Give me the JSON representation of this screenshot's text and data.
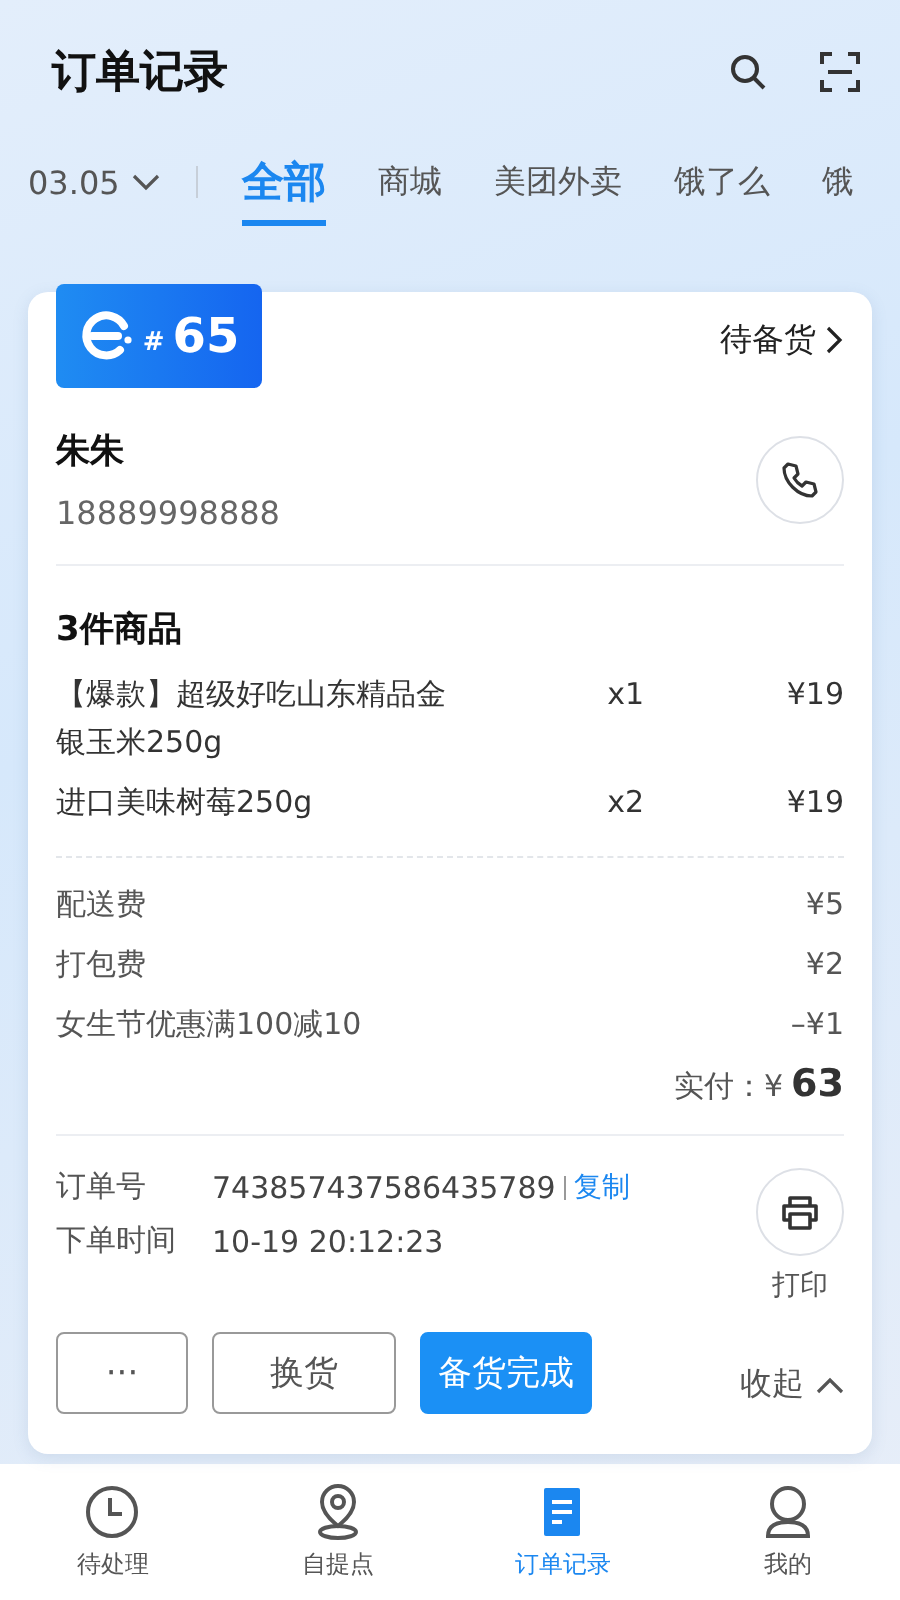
{
  "header": {
    "title": "订单记录"
  },
  "date_filter": "03.05",
  "tabs": [
    {
      "label": "全部",
      "selected": true
    },
    {
      "label": "商城",
      "selected": false
    },
    {
      "label": "美团外卖",
      "selected": false
    },
    {
      "label": "饿了么",
      "selected": false
    },
    {
      "label": "饿",
      "selected": false
    }
  ],
  "order": {
    "badge": {
      "prefix": "#",
      "number": "65"
    },
    "status": "待备货",
    "customer": {
      "name": "朱朱",
      "phone": "18889998888"
    },
    "items_title": "3件商品",
    "items": [
      {
        "name": "【爆款】超级好吃山东精品金银玉米250g",
        "qty": "x1",
        "price": "¥19"
      },
      {
        "name": "进口美味树莓250g",
        "qty": "x2",
        "price": "¥19"
      }
    ],
    "fees": [
      {
        "label": "配送费",
        "amount": "¥5"
      },
      {
        "label": "打包费",
        "amount": "¥2"
      },
      {
        "label": "女生节优惠满100减10",
        "amount": "–¥1"
      }
    ],
    "total": {
      "label": "实付：¥",
      "value": "63"
    },
    "info": [
      {
        "label": "订单号",
        "value": "743857437586435789",
        "link": "复制"
      },
      {
        "label": "下单时间",
        "value": "10-19 20:12:23"
      }
    ],
    "print_label": "打印",
    "buttons": [
      {
        "label": "···",
        "kind": "outline"
      },
      {
        "label": "换货",
        "kind": "outline"
      },
      {
        "label": "备货完成",
        "kind": "primary"
      }
    ],
    "collapse": "收起"
  },
  "bottom_nav": [
    {
      "label": "待处理",
      "selected": false
    },
    {
      "label": "自提点",
      "selected": false
    },
    {
      "label": "订单记录",
      "selected": true
    },
    {
      "label": "我的",
      "selected": false
    }
  ]
}
